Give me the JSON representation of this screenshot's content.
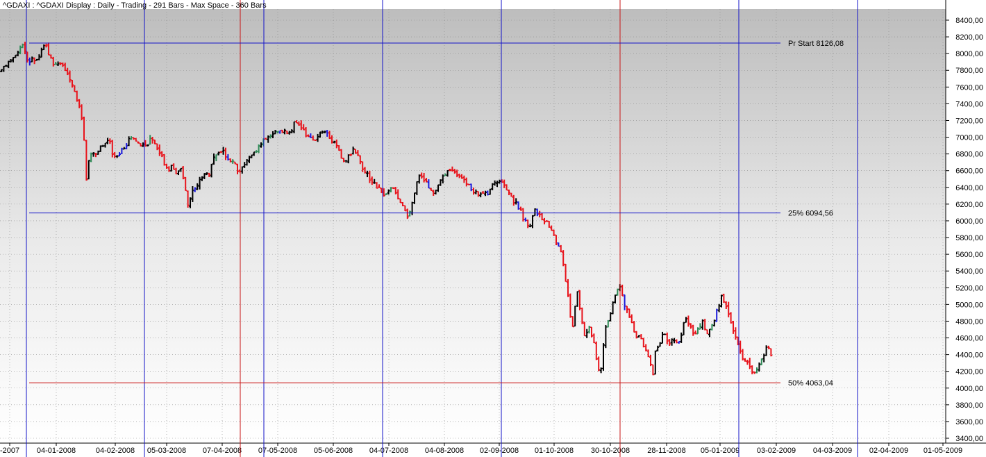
{
  "header": {
    "info": "^GDAXI : ^GDAXI Display :  Daily  - Trading - 291 Bars -  Max Space - 360 Bars"
  },
  "chart_data": {
    "type": "ohlc",
    "title": "",
    "ylim": [
      3400,
      8400
    ],
    "y_ticks": [
      3400,
      3600,
      3800,
      4000,
      4200,
      4400,
      4600,
      4800,
      5000,
      5200,
      5400,
      5600,
      5800,
      6000,
      6200,
      6400,
      6600,
      6800,
      7000,
      7200,
      7400,
      7600,
      7800,
      8000,
      8200,
      8400
    ],
    "y_tick_labels": [
      "3400,00",
      "3600,00",
      "3800,00",
      "4000,00",
      "4200,00",
      "4400,00",
      "4600,00",
      "4800,00",
      "5000,00",
      "5200,00",
      "5400,00",
      "5600,00",
      "5800,00",
      "6000,00",
      "6200,00",
      "6400,00",
      "6600,00",
      "6800,00",
      "7000,00",
      "7200,00",
      "7400,00",
      "7600,00",
      "7800,00",
      "8000,00",
      "8200,00",
      "8400,00"
    ],
    "x_ticks": [
      "-2007",
      "04-01-2008",
      "04-02-2008",
      "05-03-2008",
      "07-04-2008",
      "07-05-2008",
      "05-06-2008",
      "04-07-2008",
      "04-08-2008",
      "02-09-2008",
      "01-10-2008",
      "30-10-2008",
      "28-11-2008",
      "05-01-2009",
      "03-02-2009",
      "04-03-2009",
      "02-04-2009",
      "01-05-2009"
    ],
    "grid": true,
    "bar_colors": {
      "down": "#e8131b",
      "up": "#000000",
      "up_alt": "#2e8b57",
      "mark": "#1a1adc"
    },
    "line_colors": {
      "blue": "#1212c8",
      "red": "#c81414"
    },
    "levels": [
      {
        "label": "Pr Start 8126,08",
        "value": 8126.08,
        "color": "blue"
      },
      {
        "label": "25% 6094,56",
        "value": 6094.56,
        "color": "blue"
      },
      {
        "label": "50% 4063,04",
        "value": 4063.04,
        "color": "red"
      }
    ],
    "price_path": [
      [
        0,
        7800
      ],
      [
        8,
        7850
      ],
      [
        15,
        7900
      ],
      [
        22,
        7980
      ],
      [
        28,
        8050
      ],
      [
        35,
        8100
      ],
      [
        40,
        7880
      ],
      [
        45,
        7950
      ],
      [
        50,
        7900
      ],
      [
        55,
        7960
      ],
      [
        60,
        8050
      ],
      [
        65,
        8120
      ],
      [
        70,
        8000
      ],
      [
        75,
        7920
      ],
      [
        80,
        7850
      ],
      [
        88,
        7900
      ],
      [
        95,
        7780
      ],
      [
        102,
        7700
      ],
      [
        108,
        7520
      ],
      [
        114,
        7350
      ],
      [
        118,
        7200
      ],
      [
        121,
        6950
      ],
      [
        124,
        6500
      ],
      [
        126,
        6420
      ],
      [
        128,
        6750
      ],
      [
        132,
        6850
      ],
      [
        138,
        6800
      ],
      [
        144,
        6880
      ],
      [
        150,
        6920
      ],
      [
        156,
        7000
      ],
      [
        162,
        6800
      ],
      [
        168,
        6760
      ],
      [
        175,
        6850
      ],
      [
        182,
        6920
      ],
      [
        188,
        7000
      ],
      [
        194,
        6950
      ],
      [
        200,
        6900
      ],
      [
        206,
        6900
      ],
      [
        212,
        6920
      ],
      [
        218,
        7000
      ],
      [
        224,
        6900
      ],
      [
        230,
        6800
      ],
      [
        236,
        6700
      ],
      [
        242,
        6600
      ],
      [
        248,
        6650
      ],
      [
        254,
        6550
      ],
      [
        260,
        6650
      ],
      [
        266,
        6400
      ],
      [
        270,
        6200
      ],
      [
        274,
        6250
      ],
      [
        278,
        6400
      ],
      [
        282,
        6350
      ],
      [
        288,
        6500
      ],
      [
        294,
        6550
      ],
      [
        300,
        6550
      ],
      [
        306,
        6700
      ],
      [
        312,
        6800
      ],
      [
        318,
        6850
      ],
      [
        324,
        6800
      ],
      [
        330,
        6750
      ],
      [
        336,
        6700
      ],
      [
        342,
        6600
      ],
      [
        348,
        6620
      ],
      [
        354,
        6700
      ],
      [
        360,
        6780
      ],
      [
        366,
        6800
      ],
      [
        372,
        6900
      ],
      [
        378,
        6950
      ],
      [
        384,
        7000
      ],
      [
        390,
        7050
      ],
      [
        396,
        7080
      ],
      [
        402,
        7060
      ],
      [
        408,
        7070
      ],
      [
        414,
        7050
      ],
      [
        420,
        7100
      ],
      [
        426,
        7200
      ],
      [
        432,
        7150
      ],
      [
        438,
        7050
      ],
      [
        444,
        7000
      ],
      [
        450,
        6980
      ],
      [
        456,
        7000
      ],
      [
        462,
        7100
      ],
      [
        468,
        7050
      ],
      [
        474,
        7000
      ],
      [
        480,
        6950
      ],
      [
        486,
        6900
      ],
      [
        492,
        6750
      ],
      [
        498,
        6700
      ],
      [
        504,
        6800
      ],
      [
        510,
        6850
      ],
      [
        516,
        6750
      ],
      [
        522,
        6600
      ],
      [
        528,
        6550
      ],
      [
        534,
        6500
      ],
      [
        540,
        6420
      ],
      [
        546,
        6380
      ],
      [
        552,
        6300
      ],
      [
        558,
        6350
      ],
      [
        564,
        6400
      ],
      [
        570,
        6350
      ],
      [
        576,
        6200
      ],
      [
        582,
        6150
      ],
      [
        588,
        6050
      ],
      [
        594,
        6250
      ],
      [
        600,
        6450
      ],
      [
        606,
        6550
      ],
      [
        612,
        6500
      ],
      [
        618,
        6400
      ],
      [
        624,
        6350
      ],
      [
        630,
        6420
      ],
      [
        636,
        6500
      ],
      [
        642,
        6550
      ],
      [
        648,
        6600
      ],
      [
        654,
        6600
      ],
      [
        660,
        6550
      ],
      [
        666,
        6500
      ],
      [
        672,
        6450
      ],
      [
        678,
        6400
      ],
      [
        684,
        6350
      ],
      [
        690,
        6300
      ],
      [
        696,
        6320
      ],
      [
        702,
        6320
      ],
      [
        708,
        6400
      ],
      [
        714,
        6450
      ],
      [
        720,
        6500
      ],
      [
        726,
        6450
      ],
      [
        732,
        6350
      ],
      [
        738,
        6250
      ],
      [
        744,
        6200
      ],
      [
        750,
        6100
      ],
      [
        756,
        6000
      ],
      [
        762,
        5900
      ],
      [
        766,
        6050
      ],
      [
        770,
        6150
      ],
      [
        774,
        6100
      ],
      [
        780,
        6050
      ],
      [
        786,
        6000
      ],
      [
        792,
        5900
      ],
      [
        798,
        5800
      ],
      [
        804,
        5700
      ],
      [
        808,
        5600
      ],
      [
        812,
        5450
      ],
      [
        816,
        5200
      ],
      [
        820,
        4950
      ],
      [
        824,
        4650
      ],
      [
        828,
        4950
      ],
      [
        832,
        5150
      ],
      [
        836,
        4900
      ],
      [
        840,
        4700
      ],
      [
        844,
        4600
      ],
      [
        848,
        4750
      ],
      [
        852,
        4650
      ],
      [
        856,
        4550
      ],
      [
        860,
        4300
      ],
      [
        864,
        4100
      ],
      [
        868,
        4450
      ],
      [
        872,
        4700
      ],
      [
        876,
        4800
      ],
      [
        880,
        4950
      ],
      [
        884,
        5050
      ],
      [
        888,
        5150
      ],
      [
        892,
        5250
      ],
      [
        896,
        5100
      ],
      [
        900,
        4950
      ],
      [
        904,
        4900
      ],
      [
        908,
        4800
      ],
      [
        912,
        4700
      ],
      [
        916,
        4600
      ],
      [
        920,
        4650
      ],
      [
        924,
        4550
      ],
      [
        928,
        4500
      ],
      [
        932,
        4450
      ],
      [
        936,
        4300
      ],
      [
        940,
        4150
      ],
      [
        944,
        4450
      ],
      [
        948,
        4500
      ],
      [
        952,
        4600
      ],
      [
        956,
        4650
      ],
      [
        960,
        4550
      ],
      [
        964,
        4500
      ],
      [
        968,
        4600
      ],
      [
        972,
        4550
      ],
      [
        976,
        4500
      ],
      [
        980,
        4600
      ],
      [
        984,
        4750
      ],
      [
        988,
        4800
      ],
      [
        992,
        4750
      ],
      [
        996,
        4700
      ],
      [
        1000,
        4650
      ],
      [
        1004,
        4700
      ],
      [
        1008,
        4750
      ],
      [
        1012,
        4800
      ],
      [
        1016,
        4700
      ],
      [
        1020,
        4650
      ],
      [
        1024,
        4700
      ],
      [
        1028,
        4800
      ],
      [
        1032,
        4950
      ],
      [
        1036,
        5000
      ],
      [
        1040,
        5100
      ],
      [
        1044,
        5000
      ],
      [
        1048,
        4900
      ],
      [
        1052,
        4800
      ],
      [
        1056,
        4700
      ],
      [
        1060,
        4600
      ],
      [
        1064,
        4500
      ],
      [
        1068,
        4400
      ],
      [
        1072,
        4350
      ],
      [
        1076,
        4300
      ],
      [
        1080,
        4250
      ],
      [
        1084,
        4200
      ],
      [
        1088,
        4150
      ],
      [
        1092,
        4250
      ],
      [
        1096,
        4300
      ],
      [
        1100,
        4400
      ],
      [
        1104,
        4500
      ],
      [
        1108,
        4450
      ],
      [
        1112,
        4350
      ]
    ]
  }
}
